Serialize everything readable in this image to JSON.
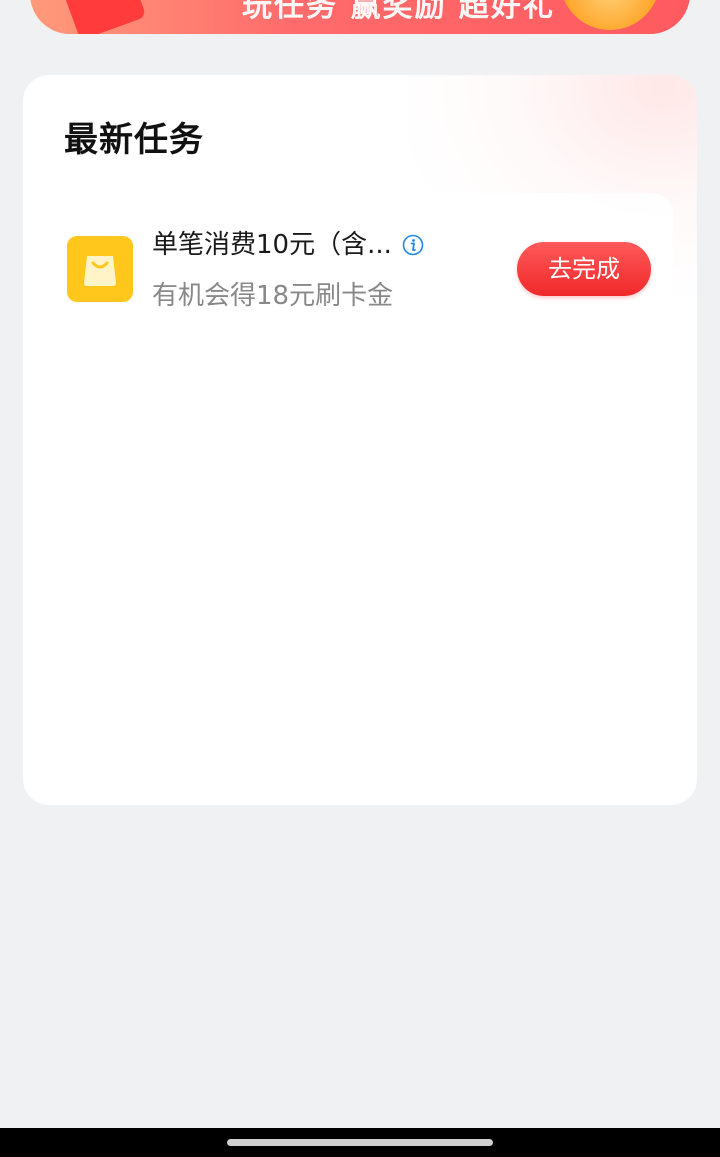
{
  "banner": {
    "text": "玩任务 赢奖励 超好礼"
  },
  "section": {
    "title": "最新任务"
  },
  "tasks": [
    {
      "icon": "shopping-bag-icon",
      "title": "单笔消费10元（含...",
      "subtitle": "有机会得18元刷卡金",
      "button_label": "去完成"
    }
  ],
  "colors": {
    "accent_red": "#f0282b",
    "icon_yellow": "#ffc61c",
    "info_blue": "#1e88e5"
  }
}
